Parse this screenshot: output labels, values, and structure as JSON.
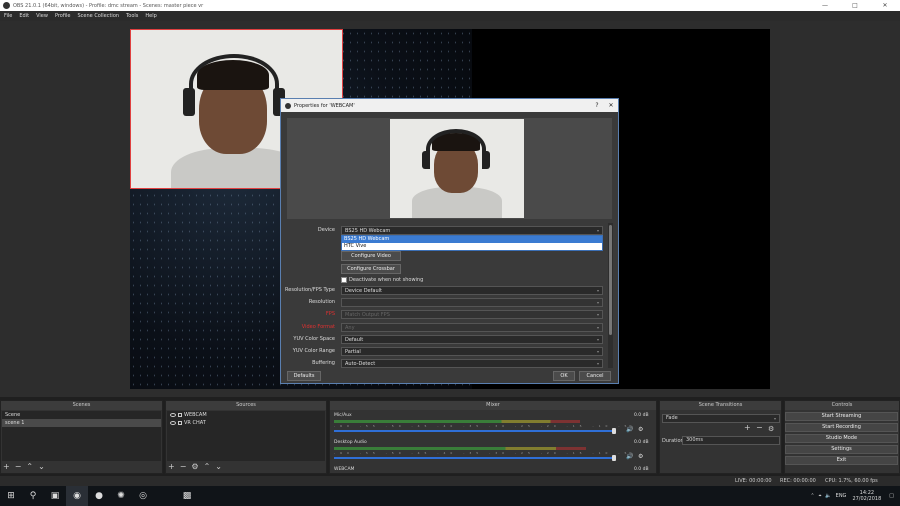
{
  "window": {
    "title": "OBS 21.0.1 (64bit, windows) - Profile: dmc stream - Scenes: master piece vr",
    "minimize": "—",
    "maximize": "□",
    "close": "✕"
  },
  "menu": [
    "File",
    "Edit",
    "View",
    "Profile",
    "Scene Collection",
    "Tools",
    "Help"
  ],
  "dialog": {
    "title": "Properties for 'WEBCAM'",
    "help": "?",
    "close": "✕",
    "device_label": "Device",
    "device_value": "BS25 HD Webcam",
    "device_options": [
      "BS25 HD Webcam",
      "HTC Vive"
    ],
    "configure_video": "Configure Video",
    "configure_crossbar": "Configure Crossbar",
    "deactivate_label": "Deactivate when not showing",
    "rows": [
      {
        "label": "Resolution/FPS Type",
        "value": "Device Default",
        "red": false,
        "disabled": false
      },
      {
        "label": "Resolution",
        "value": "",
        "red": false,
        "disabled": true
      },
      {
        "label": "FPS",
        "value": "Match Output FPS",
        "red": true,
        "disabled": true
      },
      {
        "label": "Video Format",
        "value": "Any",
        "red": true,
        "disabled": true
      },
      {
        "label": "YUV Color Space",
        "value": "Default",
        "red": false,
        "disabled": false
      },
      {
        "label": "YUV Color Range",
        "value": "Partial",
        "red": false,
        "disabled": false
      },
      {
        "label": "Buffering",
        "value": "Auto-Detect",
        "red": false,
        "disabled": false
      }
    ],
    "defaults": "Defaults",
    "ok": "OK",
    "cancel": "Cancel"
  },
  "scenes": {
    "header": "Scenes",
    "items": [
      "Scene",
      "scene 1"
    ],
    "selected": 1
  },
  "sources": {
    "header": "Sources",
    "items": [
      "WEBCAM",
      "VR CHAT"
    ]
  },
  "mixer": {
    "header": "Mixer",
    "channels": [
      {
        "name": "Mic/Aux",
        "db": "0.0 dB",
        "level": 0.82
      },
      {
        "name": "Desktop Audio",
        "db": "0.0 dB",
        "level": 0.84
      },
      {
        "name": "WEBCAM",
        "db": "0.0 dB",
        "level": 0.0
      }
    ],
    "ticks": "-60 -55 -50 -45 -40 -35 -30 -25 -20 -15 -10 -5 0"
  },
  "transitions": {
    "header": "Scene Transitions",
    "value": "Fade",
    "duration_label": "Duration",
    "duration_value": "300ms"
  },
  "controls": {
    "header": "Controls",
    "buttons": [
      "Start Streaming",
      "Start Recording",
      "Studio Mode",
      "Settings",
      "Exit"
    ]
  },
  "status": {
    "live": "LIVE: 00:00:00",
    "rec": "REC: 00:00:00",
    "cpu": "CPU: 1.7%, 60.00 fps"
  },
  "taskbar": {
    "lang": "ENG",
    "time": "14:22",
    "date": "27/02/2018"
  },
  "colors": {
    "accent": "#3b7bd1",
    "warning_label": "#e03030",
    "source_outline": "#e04040"
  }
}
